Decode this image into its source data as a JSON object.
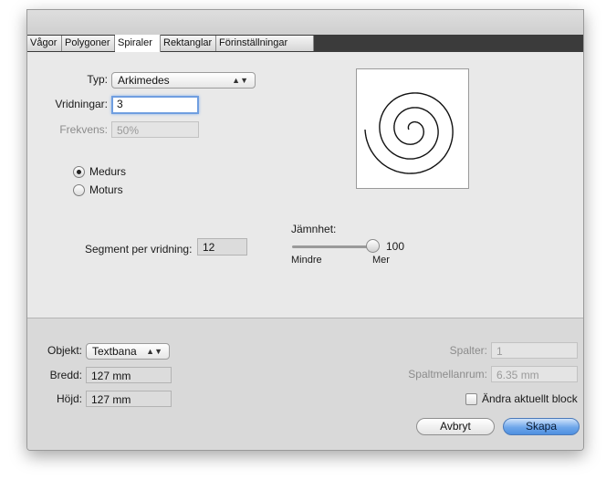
{
  "tabs": [
    "Vågor",
    "Polygoner",
    "Spiraler",
    "Rektanglar",
    "Förinställningar"
  ],
  "active_tab": "Spiraler",
  "spiral": {
    "typ_label": "Typ:",
    "typ_value": "Arkimedes",
    "vridningar_label": "Vridningar:",
    "vridningar_value": "3",
    "frekvens_label": "Frekvens:",
    "frekvens_value": "50%",
    "direction_options": [
      "Medurs",
      "Moturs"
    ],
    "direction_selected": "Medurs",
    "segment_label": "Segment per vridning:",
    "segment_value": "12",
    "jamnhet_label": "Jämnhet:",
    "jamnhet_value": "100",
    "jamnhet_level": 1.0,
    "jamnhet_min_label": "Mindre",
    "jamnhet_max_label": "Mer"
  },
  "bottom": {
    "objekt_label": "Objekt:",
    "objekt_value": "Textbana",
    "bredd_label": "Bredd:",
    "bredd_value": "127 mm",
    "hojd_label": "Höjd:",
    "hojd_value": "127 mm",
    "spalter_label": "Spalter:",
    "spalter_value": "1",
    "spaltmellanrum_label": "Spaltmellanrum:",
    "spaltmellanrum_value": "6.35 mm",
    "andra_label": "Ändra aktuellt block",
    "andra_checked": false
  },
  "buttons": {
    "cancel": "Avbryt",
    "create": "Skapa"
  },
  "colors": {
    "primary_button": "#5b96e3",
    "tab_bar": "#3b3b3b"
  }
}
